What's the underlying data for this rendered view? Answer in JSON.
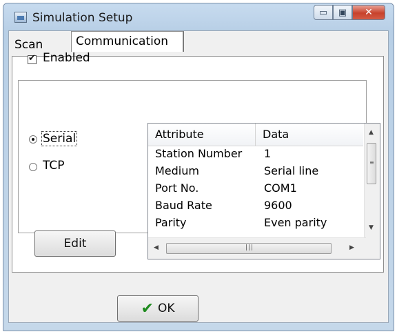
{
  "window": {
    "title": "Simulation Setup"
  },
  "tabs": [
    {
      "label": "Scan"
    },
    {
      "label": "Communication"
    }
  ],
  "communication": {
    "enabled_label": "Enabled",
    "enabled": true,
    "radios": [
      {
        "label": "Serial",
        "selected": true
      },
      {
        "label": "TCP",
        "selected": false
      }
    ],
    "edit_label": "Edit",
    "table": {
      "headers": [
        "Attribute",
        "Data"
      ],
      "rows": [
        [
          "Station Number",
          "1"
        ],
        [
          "Medium",
          "Serial line"
        ],
        [
          "Port No.",
          "COM1"
        ],
        [
          "Baud Rate",
          "9600"
        ],
        [
          "Parity",
          "Even parity"
        ]
      ]
    }
  },
  "footer": {
    "ok_label": "OK"
  },
  "icons": {
    "app": "app-icon",
    "ok": "checkmark-icon"
  },
  "colors": {
    "titlebar": "#b8cfe6",
    "close": "#c7422c",
    "ok_check": "#1e8b1e"
  }
}
